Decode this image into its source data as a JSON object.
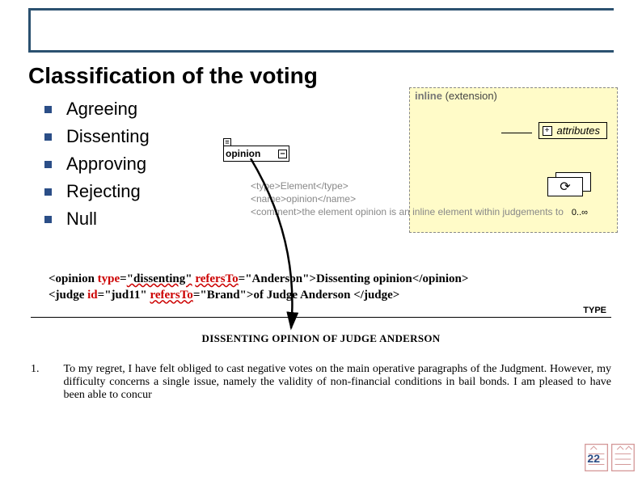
{
  "title": "Classification of the voting",
  "bullets": [
    "Agreeing",
    "Dissenting",
    "Approving",
    "Rejecting",
    "Null"
  ],
  "diagram": {
    "headerLabel": "inline",
    "headerParen": "(extension)",
    "attributes": "attributes",
    "opinionLabel": "opinion",
    "cardinality": "0..∞",
    "meta": {
      "typeLine": "<type>Element</type>",
      "nameLine": "<name>opinion</name>",
      "commentLine": "<comment>the element opinion is an inline element within judgements to"
    }
  },
  "code": {
    "line1": {
      "open": "<opinion",
      "attr1": "type",
      "val1": "\"dissenting\"",
      "attr2": "refersTo",
      "val2": "\"Anderson\"",
      "text": "Dissenting opinion",
      "close": "</opinion>"
    },
    "line2": {
      "open": "<judge",
      "attr1": "id",
      "val1": "\"jud11\"",
      "attr2": "refersTo",
      "val2": "\"Brand\"",
      "text": "of Judge Anderson ",
      "close": "</judge>"
    }
  },
  "typeHint": "TYPE",
  "doc": {
    "heading": "DISSENTING OPINION OF JUDGE ANDERSON",
    "num": "1.",
    "para": "To my regret, I have felt obliged to cast negative votes on the main operative paragraphs of the Judgment. However, my difficulty concerns a single issue, namely the validity of non-financial conditions in bail bonds. I am pleased to have been able to concur"
  },
  "pageNumber": "22"
}
